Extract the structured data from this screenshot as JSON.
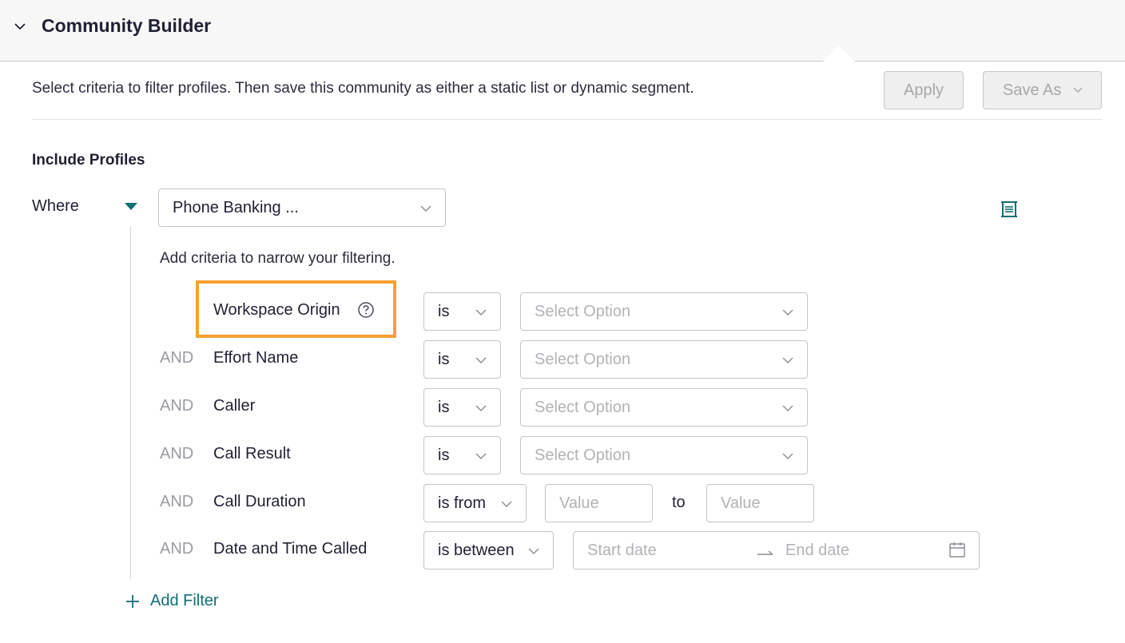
{
  "header": {
    "title": "Community Builder",
    "collapse_icon": "chevron-down-icon"
  },
  "toolbar": {
    "description": "Select criteria to filter profiles. Then save this community as either a static list or dynamic segment.",
    "apply_label": "Apply",
    "save_as_label": "Save As"
  },
  "include": {
    "heading": "Include Profiles",
    "where_label": "Where",
    "source_select": "Phone Banking ...",
    "hint": "Add criteria to narrow your filtering."
  },
  "filters": [
    {
      "conjunction": "",
      "field": "Workspace Origin",
      "operator": "is",
      "value_placeholder": "Select Option"
    },
    {
      "conjunction": "AND",
      "field": "Effort Name",
      "operator": "is",
      "value_placeholder": "Select Option"
    },
    {
      "conjunction": "AND",
      "field": "Caller",
      "operator": "is",
      "value_placeholder": "Select Option"
    },
    {
      "conjunction": "AND",
      "field": "Call Result",
      "operator": "is",
      "value_placeholder": "Select Option"
    },
    {
      "conjunction": "AND",
      "field": "Call Duration",
      "operator": "is from",
      "from_placeholder": "Value",
      "to_label": "to",
      "to_placeholder": "Value"
    },
    {
      "conjunction": "AND",
      "field": "Date and Time Called",
      "operator": "is between",
      "start_placeholder": "Start date",
      "end_placeholder": "End date"
    }
  ],
  "add_filter_label": "Add Filter",
  "colors": {
    "accent": "#0e6e74",
    "highlight": "#f7a033"
  }
}
